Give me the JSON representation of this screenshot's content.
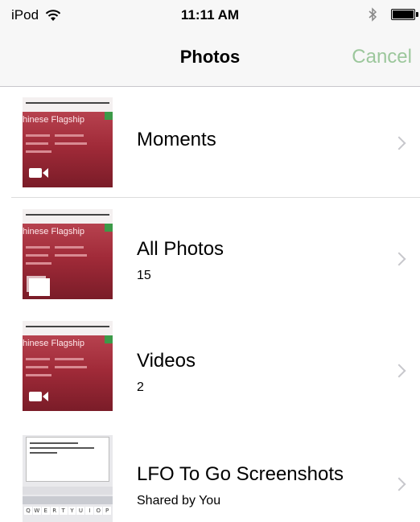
{
  "status_bar": {
    "device": "iPod",
    "time": "11:11 AM",
    "wifi_icon": "wifi-icon",
    "bluetooth_icon": "bluetooth-icon",
    "battery_icon": "battery-icon",
    "battery_level": 1.0
  },
  "nav": {
    "title": "Photos",
    "cancel_label": "Cancel",
    "cancel_color": "#9cc79c"
  },
  "albums": [
    {
      "title": "Moments",
      "subtitle": "",
      "thumb_icon": "video-camera-icon",
      "thumb_text": "hinese Flagship"
    },
    {
      "title": "All Photos",
      "subtitle": "15",
      "thumb_icon": "photo-stack-icon",
      "thumb_text": "hinese Flagship"
    },
    {
      "title": "Videos",
      "subtitle": "2",
      "thumb_icon": "video-camera-icon",
      "thumb_text": "hinese Flagship"
    },
    {
      "title": "LFO To Go Screenshots",
      "subtitle": "Shared by You",
      "thumb_icon": "keyboard-screenshot",
      "thumb_text": ""
    }
  ],
  "keyboard_keys_row1": [
    "Q",
    "W",
    "E",
    "R",
    "T",
    "Y",
    "U",
    "I",
    "O",
    "P"
  ],
  "colors": {
    "bar_background": "#f7f7f7",
    "chevron": "#c7c7cc",
    "thumb_red": "#a8323e"
  }
}
